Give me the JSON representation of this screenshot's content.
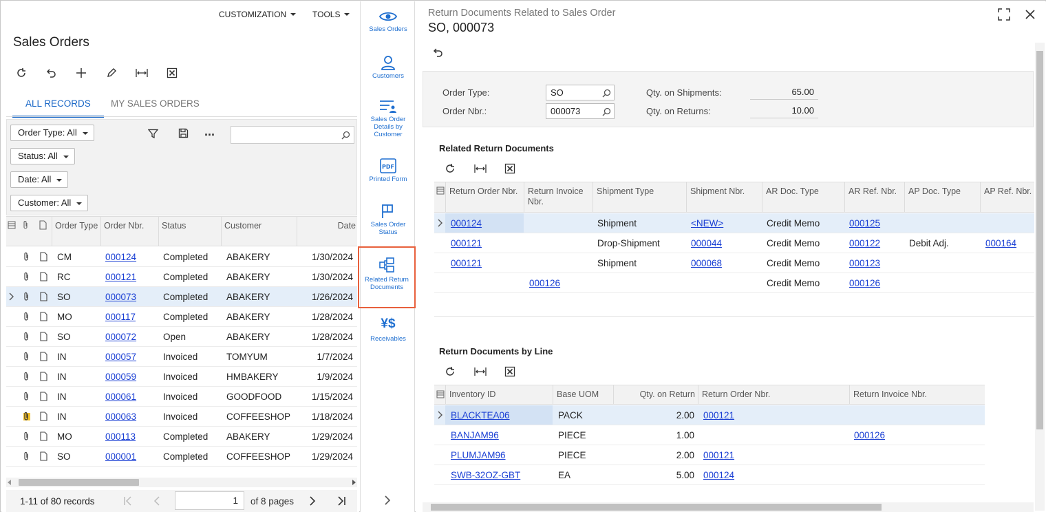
{
  "left": {
    "menu": {
      "customization": "CUSTOMIZATION",
      "tools": "TOOLS"
    },
    "title": "Sales Orders",
    "tabs": [
      "ALL RECORDS",
      "MY SALES ORDERS"
    ],
    "filters": [
      "Order Type: All",
      "Status: All",
      "Date: All",
      "Customer: All"
    ],
    "more_label": "...",
    "columns": {
      "order_type": "Order Type",
      "order_nbr": "Order Nbr.",
      "status": "Status",
      "customer": "Customer",
      "date": "Date"
    },
    "rows": [
      {
        "type": "CM",
        "nbr": "000124",
        "status": "Completed",
        "customer": "ABAKERY",
        "date": "1/30/2024"
      },
      {
        "type": "RC",
        "nbr": "000121",
        "status": "Completed",
        "customer": "ABAKERY",
        "date": "1/30/2024"
      },
      {
        "type": "SO",
        "nbr": "000073",
        "status": "Completed",
        "customer": "ABAKERY",
        "date": "1/26/2024"
      },
      {
        "type": "MO",
        "nbr": "000117",
        "status": "Completed",
        "customer": "ABAKERY",
        "date": "1/28/2024"
      },
      {
        "type": "SO",
        "nbr": "000072",
        "status": "Open",
        "customer": "ABAKERY",
        "date": "1/28/2024"
      },
      {
        "type": "IN",
        "nbr": "000057",
        "status": "Invoiced",
        "customer": "TOMYUM",
        "date": "1/7/2024"
      },
      {
        "type": "IN",
        "nbr": "000059",
        "status": "Invoiced",
        "customer": "HMBAKERY",
        "date": "1/9/2024"
      },
      {
        "type": "IN",
        "nbr": "000061",
        "status": "Invoiced",
        "customer": "GOODFOOD",
        "date": "1/15/2024"
      },
      {
        "type": "IN",
        "nbr": "000063",
        "status": "Invoiced",
        "customer": "COFFEESHOP",
        "date": "1/18/2024"
      },
      {
        "type": "MO",
        "nbr": "000113",
        "status": "Completed",
        "customer": "ABAKERY",
        "date": "1/29/2024"
      },
      {
        "type": "SO",
        "nbr": "000001",
        "status": "Completed",
        "customer": "COFFEESHOP",
        "date": "1/29/2024"
      }
    ],
    "selected_row": 2,
    "pager": {
      "info": "1-11 of 80 records",
      "page": "1",
      "of_pages": "of 8 pages"
    }
  },
  "nav": [
    {
      "label": "Sales Orders",
      "icon": "eye-icon"
    },
    {
      "label": "Customers",
      "icon": "person-icon"
    },
    {
      "label": "Sales Order Details by Customer",
      "icon": "list-person-icon"
    },
    {
      "label": "Printed Form",
      "icon": "pdf-icon"
    },
    {
      "label": "Sales Order Status",
      "icon": "flag-icon"
    },
    {
      "label": "Related Return Documents",
      "icon": "related-docs-icon"
    },
    {
      "label": "Receivables",
      "icon": "currency-icon"
    }
  ],
  "right": {
    "title": "Return Documents Related to Sales Order",
    "subtitle": "SO, 000073",
    "form": {
      "order_type_label": "Order Type:",
      "order_type": "SO",
      "order_nbr_label": "Order Nbr.:",
      "order_nbr": "000073",
      "qty_ship_label": "Qty. on Shipments:",
      "qty_ship": "65.00",
      "qty_ret_label": "Qty. on Returns:",
      "qty_ret": "10.00"
    },
    "related": {
      "title": "Related Return Documents",
      "columns": [
        "Return Order Nbr.",
        "Return Invoice Nbr.",
        "Shipment Type",
        "Shipment Nbr.",
        "AR Doc. Type",
        "AR Ref. Nbr.",
        "AP Doc. Type",
        "AP Ref. Nbr."
      ],
      "rows": [
        {
          "ret_order": "000124",
          "ret_invoice": "",
          "ship_type": "Shipment",
          "ship_nbr": "<NEW>",
          "ar_type": "Credit Memo",
          "ar_ref": "000125",
          "ap_type": "",
          "ap_ref": ""
        },
        {
          "ret_order": "000121",
          "ret_invoice": "",
          "ship_type": "Drop-Shipment",
          "ship_nbr": "000044",
          "ar_type": "Credit Memo",
          "ar_ref": "000122",
          "ap_type": "Debit Adj.",
          "ap_ref": "000164"
        },
        {
          "ret_order": "000121",
          "ret_invoice": "",
          "ship_type": "Shipment",
          "ship_nbr": "000068",
          "ar_type": "Credit Memo",
          "ar_ref": "000123",
          "ap_type": "",
          "ap_ref": ""
        },
        {
          "ret_order": "",
          "ret_invoice": "000126",
          "ship_type": "",
          "ship_nbr": "",
          "ar_type": "Credit Memo",
          "ar_ref": "000126",
          "ap_type": "",
          "ap_ref": ""
        }
      ]
    },
    "by_line": {
      "title": "Return Documents by Line",
      "columns": [
        "Inventory ID",
        "Base UOM",
        "Qty. on Return",
        "Return Order Nbr.",
        "Return Invoice Nbr."
      ],
      "rows": [
        {
          "inv": "BLACKTEA06",
          "uom": "PACK",
          "qty": "2.00",
          "ret_order": "000121",
          "ret_invoice": ""
        },
        {
          "inv": "BANJAM96",
          "uom": "PIECE",
          "qty": "1.00",
          "ret_order": "",
          "ret_invoice": "000126"
        },
        {
          "inv": "PLUMJAM96",
          "uom": "PIECE",
          "qty": "2.00",
          "ret_order": "000121",
          "ret_invoice": ""
        },
        {
          "inv": "SWB-32OZ-GBT",
          "uom": "EA",
          "qty": "5.00",
          "ret_order": "000124",
          "ret_invoice": ""
        }
      ]
    }
  },
  "colors": {
    "accent": "#1866c6",
    "link": "#1a3fd4",
    "highlight": "#e8603c",
    "selected_row": "#e4eef9"
  }
}
